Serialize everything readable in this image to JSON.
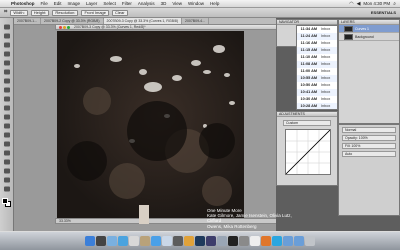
{
  "menubar": {
    "app_name": "Photoshop",
    "items": [
      "File",
      "Edit",
      "Image",
      "Layer",
      "Select",
      "Filter",
      "Analysis",
      "3D",
      "View",
      "Window",
      "Help"
    ],
    "clock": "Mon 4:30 PM"
  },
  "options_bar": {
    "controls": [
      "Width:",
      "Height:",
      "Resolution:",
      "Front Image",
      "Clear"
    ],
    "workspace": "ESSENTIALS"
  },
  "document": {
    "tabs": [
      "2007B09-1...",
      "2007B09-2 Copy @ 33.3% (RGB/8)",
      "2007B09-3 Copy @ 33.3% (Curves 1, RGB/8)",
      "2007B09-4..."
    ],
    "active_tab": 2,
    "window_title": "2007B09-3 Copy @ 33.3% (Curves 1, Red/8)*",
    "status": "33.33%"
  },
  "panels": {
    "navigator_title": "NAVIGATOR",
    "layers_title": "LAYERS",
    "layers": [
      {
        "name": "Curves 1",
        "selected": true
      },
      {
        "name": "Background",
        "selected": false
      }
    ],
    "adjustments_title": "ADJUSTMENTS",
    "adjustments_preset": "Custom",
    "props": [
      "Normal",
      "Opacity: 100%",
      "Fill: 100%",
      "Auto"
    ]
  },
  "mail": {
    "rows": [
      {
        "time": "11:34 AM",
        "box": "Inbox"
      },
      {
        "time": "11:24 AM",
        "box": "Inbox"
      },
      {
        "time": "11:16 AM",
        "box": "Inbox"
      },
      {
        "time": "11:15 AM",
        "box": "Inbox"
      },
      {
        "time": "11:10 AM",
        "box": "Inbox"
      },
      {
        "time": "11:08 AM",
        "box": "Inbox"
      },
      {
        "time": "11:00 AM",
        "box": "Inbox"
      },
      {
        "time": "10:55 AM",
        "box": "Inbox"
      },
      {
        "time": "10:50 AM",
        "box": "Inbox"
      },
      {
        "time": "10:41 AM",
        "box": "Inbox"
      },
      {
        "time": "10:30 AM",
        "box": "Inbox"
      },
      {
        "time": "10:28 AM",
        "box": "Inbox"
      }
    ]
  },
  "caption": {
    "line1": "One Minute More",
    "line2": "Kate Gilmore, Jamie Isenstein, Olivia Lutz, Clifford",
    "line3": "Owens, Mika Rottenberg"
  },
  "tools": [
    "move-tool",
    "marquee-tool",
    "lasso-tool",
    "quick-select-tool",
    "crop-tool",
    "eyedropper-tool",
    "healing-tool",
    "brush-tool",
    "stamp-tool",
    "history-brush-tool",
    "eraser-tool",
    "gradient-tool",
    "dodge-tool",
    "pen-tool",
    "type-tool",
    "path-select-tool",
    "shape-tool",
    "hand-tool",
    "zoom-tool"
  ],
  "dock_icons": [
    "finder",
    "dashboard",
    "mail",
    "safari",
    "ical",
    "address-book",
    "itunes",
    "iphoto",
    "imovie",
    "garageband",
    "photoshop",
    "bridge",
    "preview",
    "terminal",
    "system-preferences",
    "textedit",
    "firefox",
    "skype",
    "folder",
    "downloads",
    "trash"
  ],
  "colors": {
    "photo_bg": "#241d19",
    "selection": "#7f9ccf",
    "dock": "#9aa0a8"
  }
}
